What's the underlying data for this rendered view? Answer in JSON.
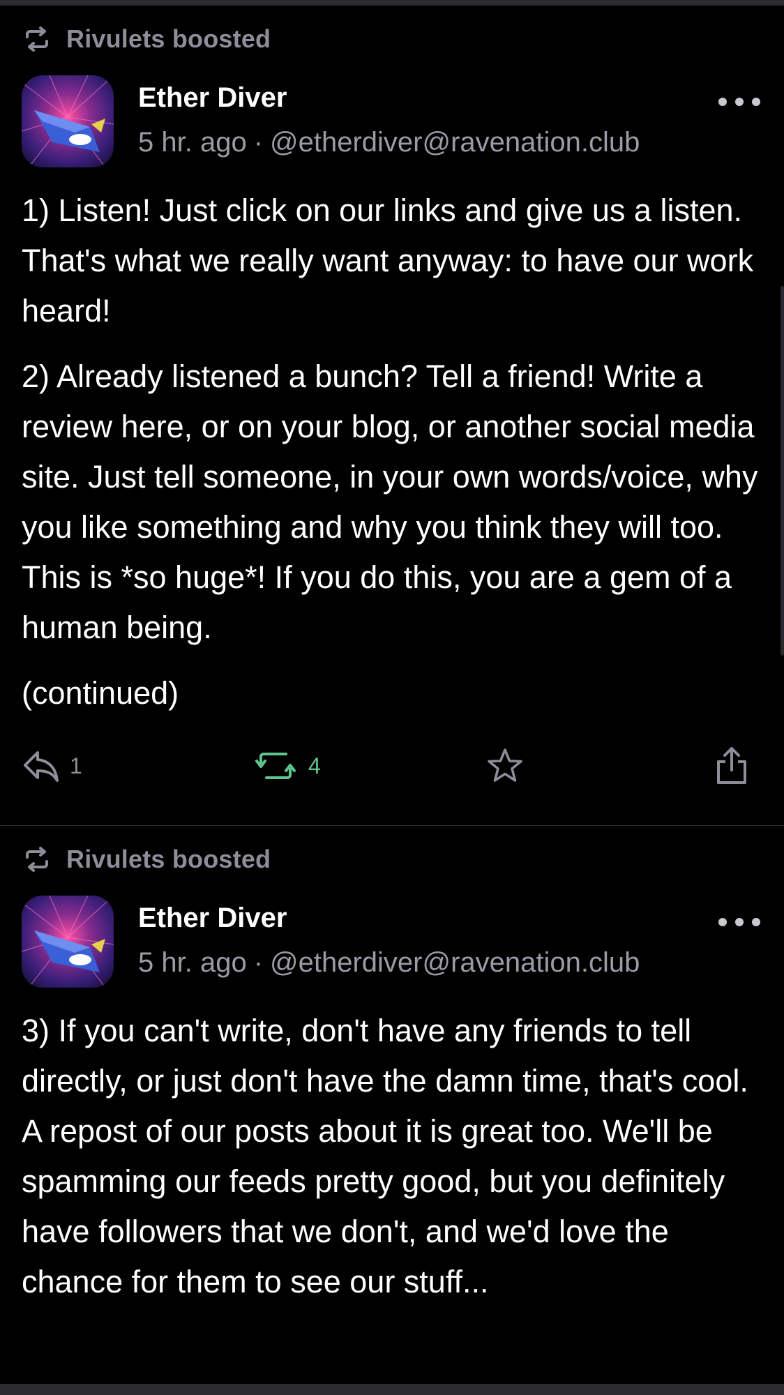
{
  "posts": [
    {
      "boosted_by": "Rivulets boosted",
      "author": {
        "display_name": "Ether Diver",
        "time": "5 hr. ago",
        "separator": "·",
        "handle": "@etherdiver@ravenation.club"
      },
      "paragraphs": [
        "1) Listen! Just click on our links and give us a listen. That's what we really want anyway: to have our work heard!",
        "2) Already listened a bunch? Tell a friend! Write a review here, or on your blog, or another social media site. Just tell someone, in your own words/voice, why you like something and why you think they will too. This is *so huge*! If you do this, you are a gem of a human being.",
        "(continued)"
      ],
      "actions": {
        "replies": "1",
        "boosts": "4",
        "favorites": "",
        "icons": [
          "reply-icon",
          "boost-icon",
          "star-icon",
          "share-icon"
        ]
      }
    },
    {
      "boosted_by": "Rivulets boosted",
      "author": {
        "display_name": "Ether Diver",
        "time": "5 hr. ago",
        "separator": "·",
        "handle": "@etherdiver@ravenation.club"
      },
      "paragraphs": [
        "3) If you can't write, don't have any friends to tell directly, or just don't have the damn time, that's cool. A repost of our posts about it is great too. We'll be spamming our feeds pretty good, but you definitely have followers that we don't, and we'd love the chance for them to see our stuff..."
      ]
    }
  ],
  "colors": {
    "background": "#000000",
    "muted_text": "#9a9ba5",
    "boost_active": "#5fc58f",
    "divider": "#2c2c30"
  }
}
